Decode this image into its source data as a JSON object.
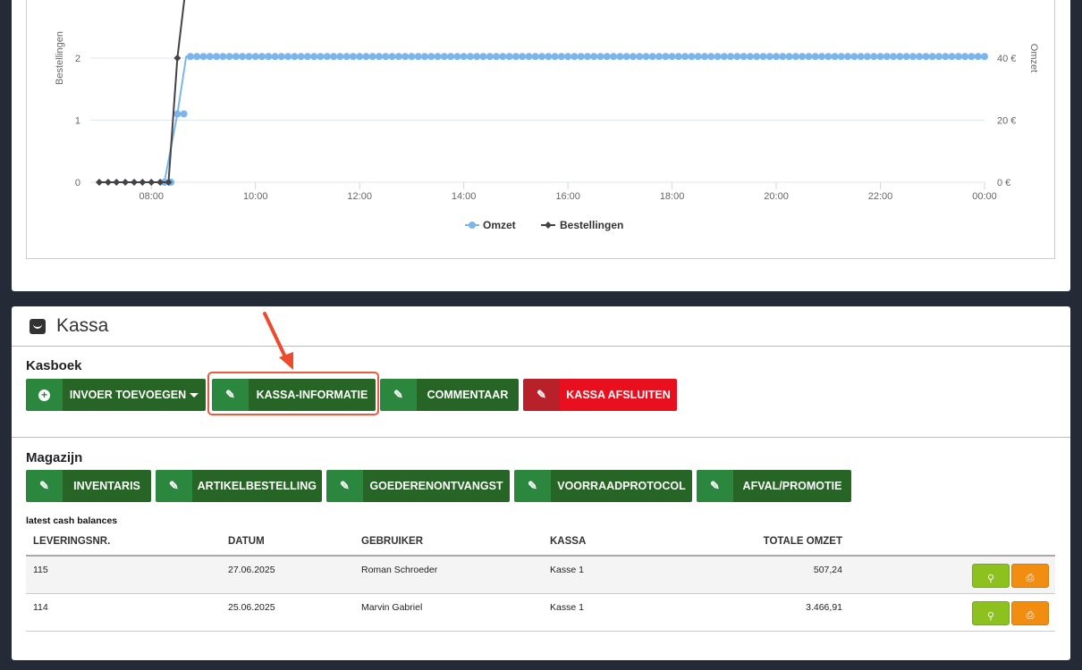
{
  "chart_data": {
    "type": "line",
    "legend": [
      "Omzet",
      "Bestellingen"
    ],
    "legend_position": "bottom",
    "xlabel": "",
    "ylabel_left": "Bestellingen",
    "ylabel_right": "Omzet",
    "x_ticks": [
      "08:00",
      "10:00",
      "12:00",
      "14:00",
      "16:00",
      "18:00",
      "20:00",
      "22:00",
      "00:00"
    ],
    "y_left_ticks": [
      "0",
      "1",
      "2"
    ],
    "y_right_ticks": [
      "0 €",
      "20 €",
      "40 €"
    ],
    "x_range_hours": [
      7,
      24
    ],
    "y_left_range": [
      0,
      3
    ],
    "y_right_range": [
      0,
      60
    ],
    "grid": true,
    "series": [
      {
        "name": "Omzet",
        "color": "#7cb5ec",
        "description": "0 until ~08:25, ~22 at 08:30, ~40.5 from 08:40 to 24:00",
        "points": [
          [
            8.25,
            0
          ],
          [
            8.5,
            22
          ],
          [
            8.67,
            40.5
          ],
          [
            24,
            40.5
          ]
        ]
      },
      {
        "name": "Bestellingen",
        "color": "#434348",
        "points": [
          [
            7.0,
            0
          ],
          [
            7.17,
            0
          ],
          [
            7.33,
            0
          ],
          [
            7.5,
            0
          ],
          [
            7.67,
            0
          ],
          [
            7.83,
            0
          ],
          [
            8.0,
            0
          ],
          [
            8.17,
            0
          ],
          [
            8.33,
            0
          ],
          [
            8.5,
            2
          ],
          [
            8.67,
            3.2
          ]
        ]
      }
    ]
  },
  "kassa": {
    "title": "Kassa",
    "kasboek_title": "Kasboek",
    "buttons": {
      "invoer": "INVOER TOEVOEGEN",
      "kassa_info": "KASSA-INFORMATIE",
      "commentaar": "COMMENTAAR",
      "afsluiten": "KASSA AFSLUITEN"
    },
    "magazijn_title": "Magazijn",
    "magazijn_buttons": {
      "inventaris": "INVENTARIS",
      "artikelbestelling": "ARTIKELBESTELLING",
      "goederenontvangst": "GOEDERENONTVANGST",
      "voorraadprotocol": "VOORRAADPROTOCOL",
      "afval": "AFVAL/PROMOTIE"
    },
    "table_caption": "latest cash balances",
    "columns": [
      "LEVERINGSNR.",
      "DATUM",
      "GEBRUIKER",
      "KASSA",
      "TOTALE OMZET"
    ],
    "rows": [
      {
        "nr": "115",
        "datum": "27.06.2025",
        "gebruiker": "Roman Schroeder",
        "kassa": "Kasse 1",
        "omzet": "507,24"
      },
      {
        "nr": "114",
        "datum": "25.06.2025",
        "gebruiker": "Marvin Gabriel",
        "kassa": "Kasse 1",
        "omzet": "3.466,91"
      }
    ]
  }
}
